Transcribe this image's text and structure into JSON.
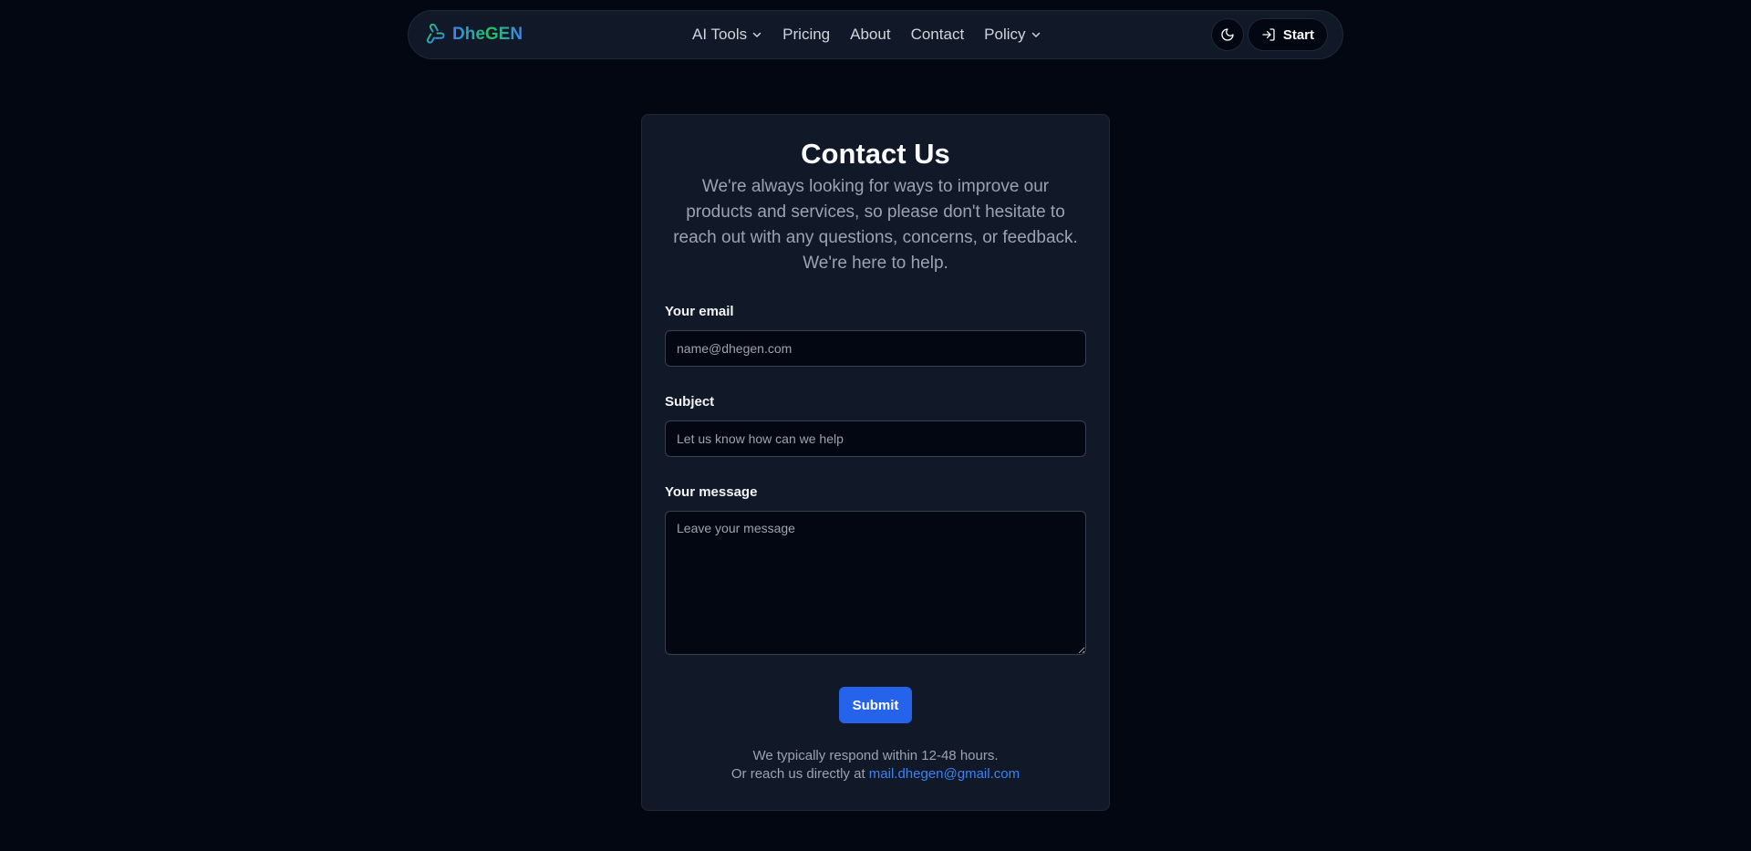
{
  "nav": {
    "brand": "DheGEN",
    "brand_icon": "dhegen-logo-icon",
    "items": [
      {
        "label": "AI Tools",
        "dropdown": true
      },
      {
        "label": "Pricing",
        "dropdown": false
      },
      {
        "label": "About",
        "dropdown": false
      },
      {
        "label": "Contact",
        "dropdown": false
      },
      {
        "label": "Policy",
        "dropdown": true
      }
    ],
    "theme_icon": "moon-icon",
    "start_label": "Start",
    "start_icon": "sign-in-icon"
  },
  "contact": {
    "title": "Contact Us",
    "subtitle": "We're always looking for ways to improve our products and services, so please don't hesitate to reach out with any questions, concerns, or feedback. We're here to help.",
    "email_label": "Your email",
    "email_placeholder": "name@dhegen.com",
    "subject_label": "Subject",
    "subject_placeholder": "Let us know how can we help",
    "message_label": "Your message",
    "message_placeholder": "Leave your message",
    "submit_label": "Submit",
    "response_note": "We typically respond within 12-48 hours.",
    "direct_prefix": "Or reach us directly at",
    "direct_email": "mail.dhegen@gmail.com"
  },
  "colors": {
    "background": "#030712",
    "card": "#111827",
    "accent": "#2563eb",
    "link": "#3b82f6",
    "brand_gradient": [
      "#3b82f6",
      "#22c55e"
    ]
  }
}
